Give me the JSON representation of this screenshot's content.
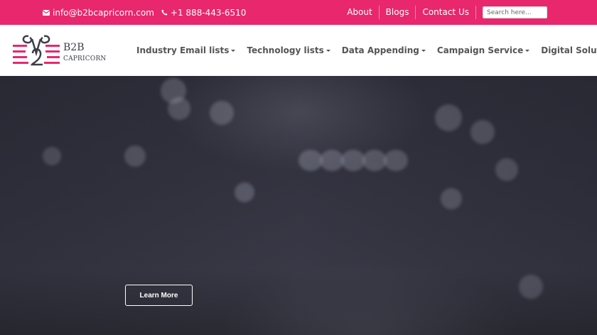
{
  "topbar": {
    "email": "info@b2bcapricorn.com",
    "phone": "+1 888-443-6510",
    "links": [
      "About",
      "Blogs",
      "Contact Us"
    ],
    "search_placeholder": "Search here...",
    "bg_color": "#e8276c"
  },
  "logo": {
    "line1": "B2B",
    "line2": "CAPRICORN"
  },
  "menu": {
    "items": [
      "Industry Email lists",
      "Technology lists",
      "Data Appending",
      "Campaign Service",
      "Digital Solutions"
    ]
  },
  "hero": {
    "button_label": "Learn More"
  },
  "icons": {
    "email": "envelope-icon",
    "phone": "phone-icon",
    "dropdown": "caret-down-icon"
  }
}
